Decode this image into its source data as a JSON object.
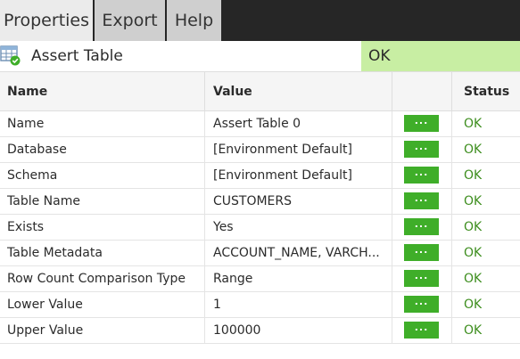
{
  "tabs": [
    {
      "label": "Properties",
      "active": true
    },
    {
      "label": "Export",
      "active": false
    },
    {
      "label": "Help",
      "active": false
    }
  ],
  "component": {
    "title": "Assert Table",
    "status": "OK",
    "icon": "table-check-icon"
  },
  "table": {
    "headers": {
      "name": "Name",
      "value": "Value",
      "edit": "",
      "status": "Status"
    },
    "rows": [
      {
        "name": "Name",
        "value": "Assert Table 0",
        "edit": "...",
        "status": "OK"
      },
      {
        "name": "Database",
        "value": "[Environment Default]",
        "edit": "...",
        "status": "OK"
      },
      {
        "name": "Schema",
        "value": "[Environment Default]",
        "edit": "...",
        "status": "OK"
      },
      {
        "name": "Table Name",
        "value": "CUSTOMERS",
        "edit": "...",
        "status": "OK"
      },
      {
        "name": "Exists",
        "value": "Yes",
        "edit": "...",
        "status": "OK"
      },
      {
        "name": "Table Metadata",
        "value": "ACCOUNT_NAME, VARCH...",
        "edit": "...",
        "status": "OK"
      },
      {
        "name": "Row Count Comparison Type",
        "value": "Range",
        "edit": "...",
        "status": "OK"
      },
      {
        "name": "Lower Value",
        "value": "1",
        "edit": "...",
        "status": "OK"
      },
      {
        "name": "Upper Value",
        "value": "100000",
        "edit": "...",
        "status": "OK"
      }
    ]
  },
  "colors": {
    "tabbar_bg": "#262626",
    "ok_banner": "#c8eea3",
    "edit_button": "#3fae29",
    "status_ok_text": "#3e8e1f"
  }
}
